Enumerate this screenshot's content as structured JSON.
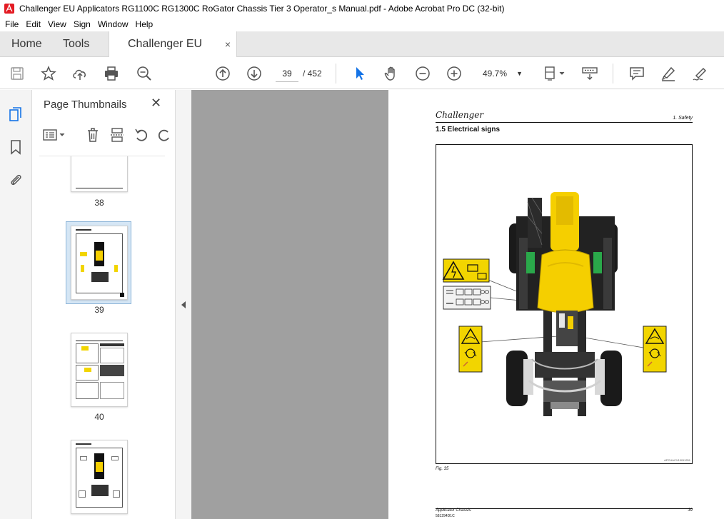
{
  "window": {
    "title": "Challenger EU Applicators RG1100C RG1300C RoGator Chassis Tier 3 Operator_s Manual.pdf - Adobe Acrobat Pro DC (32-bit)"
  },
  "menu": [
    "File",
    "Edit",
    "View",
    "Sign",
    "Window",
    "Help"
  ],
  "tabs": {
    "home": "Home",
    "tools": "Tools",
    "document": "Challenger EU Appl...",
    "close": "×"
  },
  "toolbar": {
    "current_page": "39",
    "page_total": "/  452",
    "zoom": "49.7%"
  },
  "thumbnails": {
    "title": "Page Thumbnails",
    "close": "✕",
    "items": [
      {
        "label": "38"
      },
      {
        "label": "39"
      },
      {
        "label": "40"
      },
      {
        "label": ""
      }
    ]
  },
  "page": {
    "brand": "Challenger",
    "section": "1. Safety",
    "heading": "1.5   Electrical signs",
    "figure_ref": "APCUACV10011251",
    "figure_caption": "Fig. 35",
    "footer_title": "Applicator Chassis",
    "footer_code": "581294D1C",
    "page_number": "39"
  },
  "colors": {
    "accent": "#1473e6",
    "adobe_red": "#e31b23",
    "machine_yellow": "#f5cf00",
    "decal_yellow": "#f2d500"
  }
}
